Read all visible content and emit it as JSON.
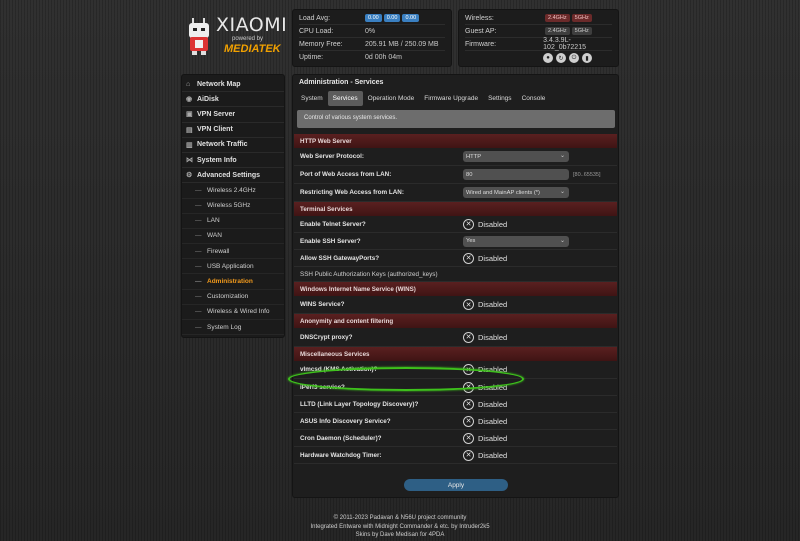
{
  "logo": {
    "brand": "XIAOMI",
    "powered": "powered by",
    "partner": "MEDIATEK"
  },
  "stats": {
    "load_avg_label": "Load Avg:",
    "load_avg": [
      "0.00",
      "0.00",
      "0.00"
    ],
    "cpu_label": "CPU Load:",
    "cpu": "0%",
    "memory_label": "Memory Free:",
    "memory": "205.91 MB / 250.09 MB",
    "uptime_label": "Uptime:",
    "uptime": "0d 00h 04m"
  },
  "status": {
    "wireless_label": "Wireless:",
    "wireless": [
      "2.4GHz",
      "5GHz"
    ],
    "guest_label": "Guest AP:",
    "guest": [
      "2.4GHz",
      "5GHz"
    ],
    "firmware_label": "Firmware:",
    "firmware": "3.4.3.9L-102_0b72215"
  },
  "sidebar": {
    "items": [
      {
        "label": "Network Map",
        "icon": "home-icon"
      },
      {
        "label": "AiDisk",
        "icon": "disk-icon"
      },
      {
        "label": "VPN Server",
        "icon": "lock-icon"
      },
      {
        "label": "VPN Client",
        "icon": "client-icon"
      },
      {
        "label": "Network Traffic",
        "icon": "chart-icon"
      },
      {
        "label": "System Info",
        "icon": "info-icon"
      },
      {
        "label": "Advanced Settings",
        "icon": "gear-icon"
      }
    ],
    "subitems": [
      "Wireless 2.4GHz",
      "Wireless 5GHz",
      "LAN",
      "WAN",
      "Firewall",
      "USB Application",
      "Administration",
      "Customization",
      "Wireless & Wired Info",
      "System Log"
    ]
  },
  "main": {
    "title": "Administration - Services",
    "tabs": [
      "System",
      "Services",
      "Operation Mode",
      "Firmware Upgrade",
      "Settings",
      "Console"
    ],
    "description": "Control of various system services."
  },
  "sections": {
    "http": "HTTP Web Server",
    "terminal": "Terminal Services",
    "wins": "Windows Internet Name Service (WINS)",
    "anon": "Anonymity and content filtering",
    "misc": "Miscellaneous Services"
  },
  "fields": {
    "web_protocol": {
      "label": "Web Server Protocol:",
      "value": "HTTP"
    },
    "web_port": {
      "label": "Port of Web Access from LAN:",
      "value": "80",
      "hint": "[80..65535]"
    },
    "web_restrict": {
      "label": "Restricting Web Access from LAN:",
      "value": "Wired and MainAP clients (*)"
    },
    "telnet": {
      "label": "Enable Telnet Server?",
      "value": "Disabled"
    },
    "ssh": {
      "label": "Enable SSH Server?",
      "value": "Yes"
    },
    "ssh_gw": {
      "label": "Allow SSH GatewayPorts?",
      "value": "Disabled"
    },
    "ssh_keys": {
      "label": "SSH Public Authorization Keys (authorized_keys)"
    },
    "wins": {
      "label": "WINS Service?",
      "value": "Disabled"
    },
    "dnscrypt": {
      "label": "DNSCrypt proxy?",
      "value": "Disabled"
    },
    "vlmcsd": {
      "label": "vlmcsd (KMS Activation)?",
      "value": "Disabled"
    },
    "iperf": {
      "label": "iPerf3 service?",
      "value": "Disabled"
    },
    "lltd": {
      "label": "LLTD (Link Layer Topology Discovery)?",
      "value": "Disabled"
    },
    "asus": {
      "label": "ASUS Info Discovery Service?",
      "value": "Disabled"
    },
    "cron": {
      "label": "Cron Daemon (Scheduler)?",
      "value": "Disabled"
    },
    "watchdog": {
      "label": "Hardware Watchdog Timer:",
      "value": "Disabled"
    }
  },
  "apply_label": "Apply",
  "footer": [
    "© 2011-2023 Padavan & N56U project community",
    "Integrated Entware with Midnight Commander & etc. by Intruder2k5",
    "Skins by Dave Medisan for 4PDA"
  ],
  "colors": {
    "accent": "#f29a1c",
    "section": "#4a1a1a",
    "highlight": "#3ec11c",
    "apply": "#2e5f85"
  }
}
